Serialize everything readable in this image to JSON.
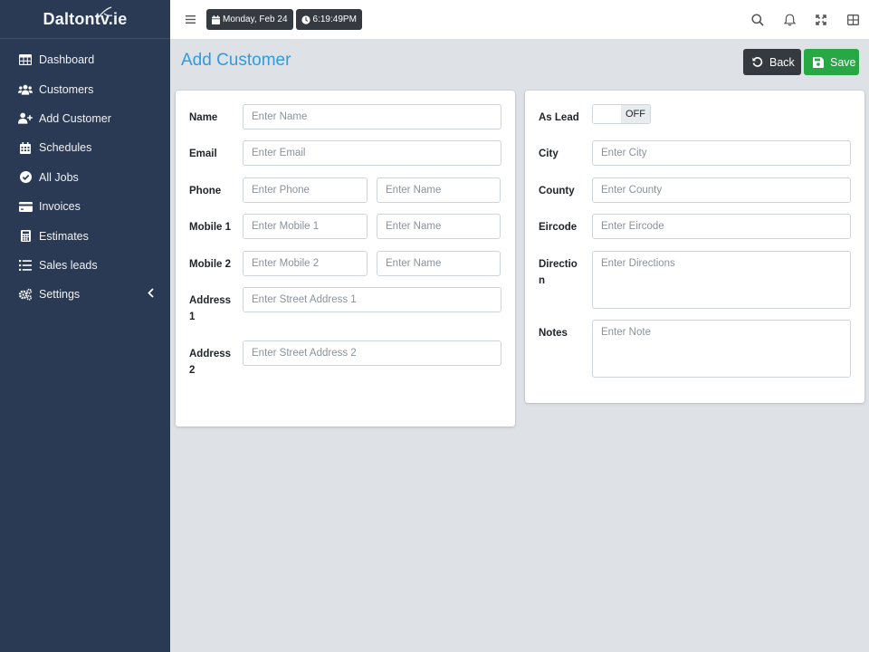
{
  "brand": {
    "name": "Daltontv.ie"
  },
  "sidebar": {
    "items": [
      {
        "label": "Dashboard",
        "icon": "table-icon"
      },
      {
        "label": "Customers",
        "icon": "users-icon"
      },
      {
        "label": "Add Customer",
        "icon": "user-plus-icon"
      },
      {
        "label": "Schedules",
        "icon": "calendar-icon"
      },
      {
        "label": "All Jobs",
        "icon": "check-circle-icon"
      },
      {
        "label": "Invoices",
        "icon": "credit-card-icon"
      },
      {
        "label": "Estimates",
        "icon": "calculator-icon"
      },
      {
        "label": "Sales leads",
        "icon": "list-icon"
      },
      {
        "label": "Settings",
        "icon": "cogs-icon"
      }
    ]
  },
  "topbar": {
    "date": "Monday, Feb 24",
    "time": "6:19:49PM"
  },
  "page": {
    "title": "Add Customer",
    "back_label": "Back",
    "save_label": "Save"
  },
  "form_left": {
    "name": {
      "label": "Name",
      "placeholder": "Enter Name"
    },
    "email": {
      "label": "Email",
      "placeholder": "Enter Email"
    },
    "phone": {
      "label": "Phone",
      "placeholder": "Enter Phone",
      "name_placeholder": "Enter Name"
    },
    "mobile1": {
      "label": "Mobile 1",
      "placeholder": "Enter Mobile 1",
      "name_placeholder": "Enter Name"
    },
    "mobile2": {
      "label": "Mobile 2",
      "placeholder": "Enter Mobile 2",
      "name_placeholder": "Enter Name"
    },
    "address1": {
      "label_line1": "Address",
      "label_line2": "1",
      "placeholder": "Enter Street Address 1"
    },
    "address2": {
      "label_line1": "Address",
      "label_line2": "2",
      "placeholder": "Enter Street Address 2"
    }
  },
  "form_right": {
    "as_lead": {
      "label": "As Lead",
      "state": "OFF"
    },
    "city": {
      "label": "City",
      "placeholder": "Enter City"
    },
    "county": {
      "label": "County",
      "placeholder": "Enter County"
    },
    "eircode": {
      "label": "Eircode",
      "placeholder": "Enter Eircode"
    },
    "directions": {
      "label_line1": "Directio",
      "label_line2": "n",
      "placeholder": "Enter Directions"
    },
    "notes": {
      "label": "Notes",
      "placeholder": "Enter Note"
    }
  },
  "colors": {
    "sidebar_bg": "#2a3a54",
    "accent": "#2e9be0",
    "save": "#28a745",
    "dark": "#343a40",
    "content_bg": "#dee2e6"
  }
}
